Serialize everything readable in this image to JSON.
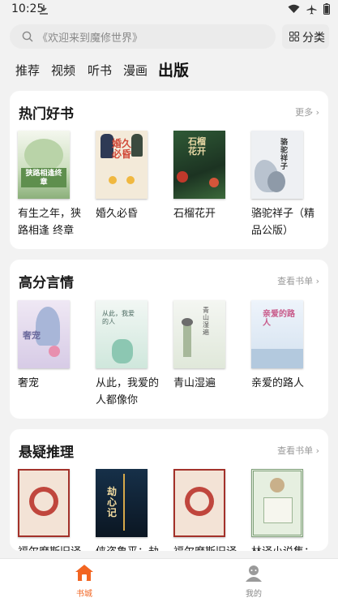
{
  "status_bar": {
    "time": "10:25"
  },
  "search": {
    "placeholder": "《欢迎来到魔修世界》"
  },
  "category_button": {
    "label": "分类"
  },
  "tabs": [
    {
      "label": "推荐",
      "active": false
    },
    {
      "label": "视频",
      "active": false
    },
    {
      "label": "听书",
      "active": false
    },
    {
      "label": "漫画",
      "active": false
    },
    {
      "label": "出版",
      "active": true
    }
  ],
  "sections": [
    {
      "title": "热门好书",
      "more_label": "更多",
      "books": [
        {
          "title": "有生之年，狭路相逢 终章",
          "cover_text": "狭路相逢终章",
          "cover_color": "#dfe8d8"
        },
        {
          "title": "婚久必昏",
          "cover_text": "婚久必昏",
          "cover_color": "#f3ead9"
        },
        {
          "title": "石榴花开",
          "cover_text": "石榴花开",
          "cover_color": "#23402a"
        },
        {
          "title": "骆驼祥子（精品公版）",
          "cover_text": "骆驼祥子",
          "cover_color": "#eef0f3"
        }
      ]
    },
    {
      "title": "高分言情",
      "more_label": "查看书单",
      "books": [
        {
          "title": "奢宠",
          "cover_text": "奢宠",
          "cover_color": "#e6e0ee"
        },
        {
          "title": "从此，我爱的人都像你",
          "cover_text": "从此，我爱的人",
          "cover_color": "#dfeee7"
        },
        {
          "title": "青山湿遍",
          "cover_text": "青山湿遍",
          "cover_color": "#edf1ea"
        },
        {
          "title": "亲爱的路人",
          "cover_text": "亲爱的路人",
          "cover_color": "#e3ecf6"
        }
      ]
    },
    {
      "title": "悬疑推理",
      "more_label": "查看书单",
      "books": [
        {
          "title": "福尔摩斯旧译",
          "cover_text": "",
          "cover_color": "#f3e3d6"
        },
        {
          "title": "侠盗鲁平：劫",
          "cover_text": "劫心记",
          "cover_color": "#0e1e2e"
        },
        {
          "title": "福尔摩斯旧译",
          "cover_text": "",
          "cover_color": "#f3e3d6"
        },
        {
          "title": "林译小说集：",
          "cover_text": "",
          "cover_color": "#e6efe0"
        }
      ]
    }
  ],
  "bottom_nav": [
    {
      "label": "书城",
      "active": true
    },
    {
      "label": "我的",
      "active": false
    }
  ],
  "colors": {
    "accent": "#f26522",
    "page_bg": "#f2f2f2"
  }
}
